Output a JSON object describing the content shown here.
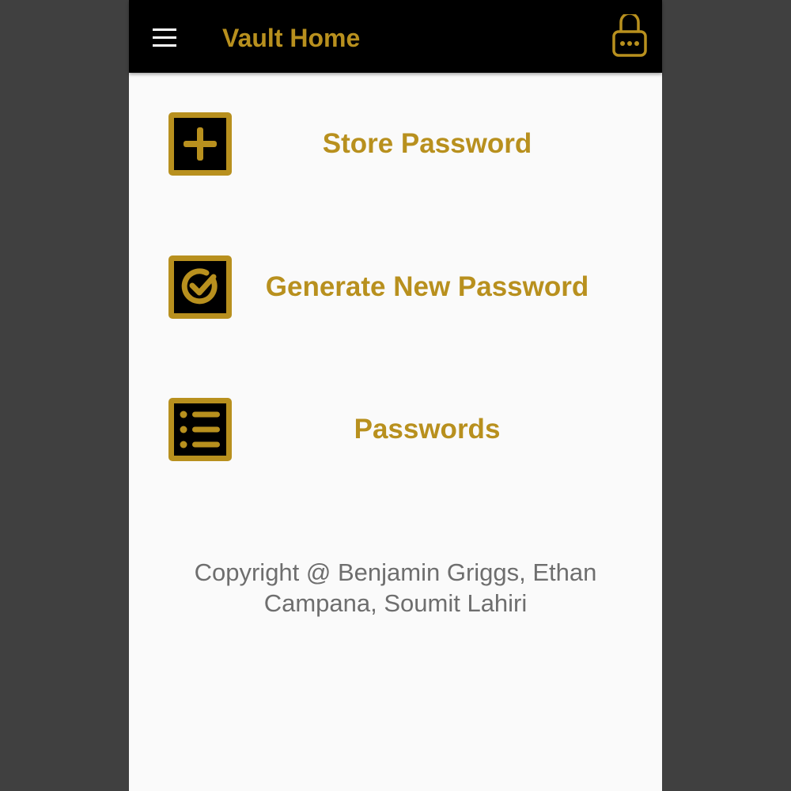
{
  "colors": {
    "accent": "#b8901e",
    "appbar_bg": "#000000",
    "page_bg": "#fafafa",
    "outer_bg": "#404040",
    "copyright_text": "#6e6e6e"
  },
  "appbar": {
    "title": "Vault Home",
    "menu_icon": "hamburger-menu-icon",
    "lock_icon": "password-lock-icon"
  },
  "menu": [
    {
      "label": "Store Password",
      "icon": "add-box-icon"
    },
    {
      "label": "Generate New Password",
      "icon": "check-circle-box-icon"
    },
    {
      "label": "Passwords",
      "icon": "list-box-icon"
    }
  ],
  "footer": {
    "copyright": "Copyright @ Benjamin Griggs, Ethan Campana, Soumit Lahiri"
  }
}
